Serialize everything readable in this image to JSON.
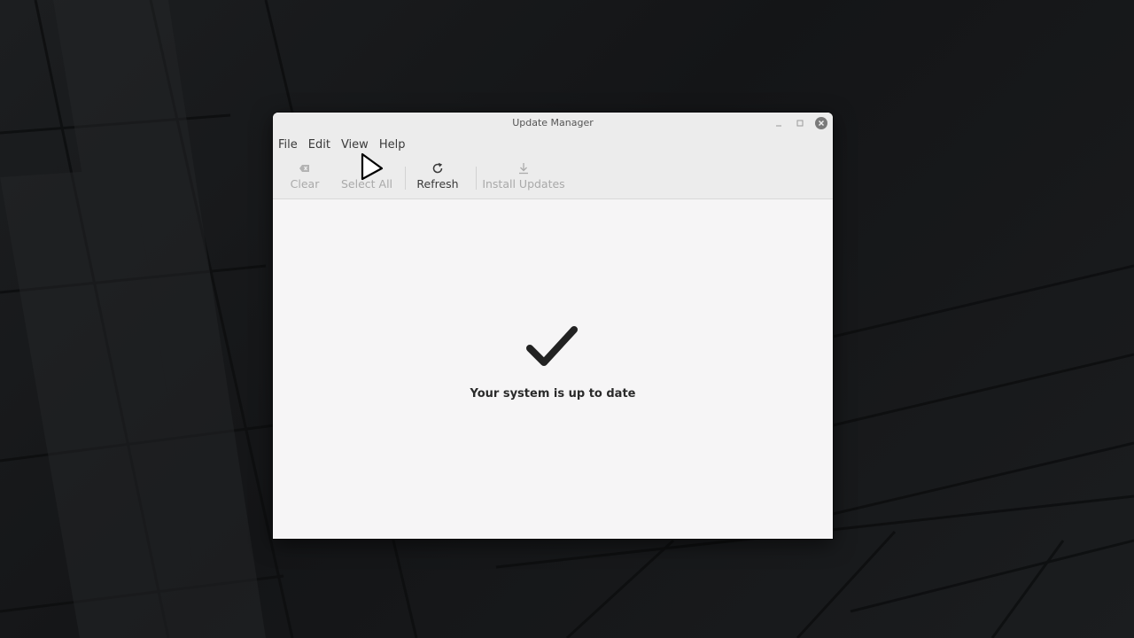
{
  "window": {
    "title": "Update Manager"
  },
  "menu": {
    "items": [
      {
        "label": "File"
      },
      {
        "label": "Edit"
      },
      {
        "label": "View"
      },
      {
        "label": "Help"
      }
    ]
  },
  "toolbar": {
    "clear": {
      "label": "Clear",
      "icon": "clear-icon",
      "enabled": false
    },
    "select_all": {
      "label": "Select All",
      "enabled": false
    },
    "refresh": {
      "label": "Refresh",
      "icon": "refresh-icon",
      "enabled": true
    },
    "install_updates": {
      "label": "Install Updates",
      "icon": "download-icon",
      "enabled": false
    }
  },
  "status": {
    "icon": "checkmark-icon",
    "message": "Your system is up to date"
  },
  "colors": {
    "window_bg": "#f6f5f6",
    "chrome_bg": "#ececec",
    "disabled_text": "#a9a9a9",
    "text": "#3a3a3a",
    "close_button": "#7a7a7a"
  }
}
